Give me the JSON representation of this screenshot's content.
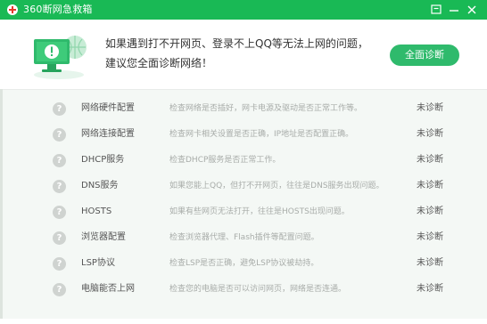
{
  "window": {
    "title": "360断网急救箱",
    "accent_color": "#19b955"
  },
  "titlebar": {
    "icons": [
      "menu-icon",
      "minimize-icon",
      "close-icon"
    ]
  },
  "header": {
    "line1": "如果遇到打不开网页、登录不上QQ等无法上网的问题，",
    "line2": "建议您全面诊断网络！",
    "button_label": "全面诊断",
    "button_color": "#2fba6c"
  },
  "checks": [
    {
      "name": "网络硬件配置",
      "desc": "检查网络是否插好，网卡电源及驱动是否正常工作等。",
      "status": "未诊断"
    },
    {
      "name": "网络连接配置",
      "desc": "检查网卡相关设置是否正确，IP地址是否配置正确。",
      "status": "未诊断"
    },
    {
      "name": "DHCP服务",
      "desc": "检查DHCP服务是否正常工作。",
      "status": "未诊断"
    },
    {
      "name": "DNS服务",
      "desc": "如果您能上QQ，但打不开网页，往往是DNS服务出现问题。",
      "status": "未诊断"
    },
    {
      "name": "HOSTS",
      "desc": "如果有些网页无法打开，往往是HOSTS出现问题。",
      "status": "未诊断"
    },
    {
      "name": "浏览器配置",
      "desc": "检查浏览器代理、Flash插件等配置问题。",
      "status": "未诊断"
    },
    {
      "name": "LSP协议",
      "desc": "检查LSP是否正确，避免LSP协议被劫持。",
      "status": "未诊断"
    },
    {
      "name": "电脑能否上网",
      "desc": "检查您的电脑是否可以访问网页，网络是否连通。",
      "status": "未诊断"
    }
  ]
}
